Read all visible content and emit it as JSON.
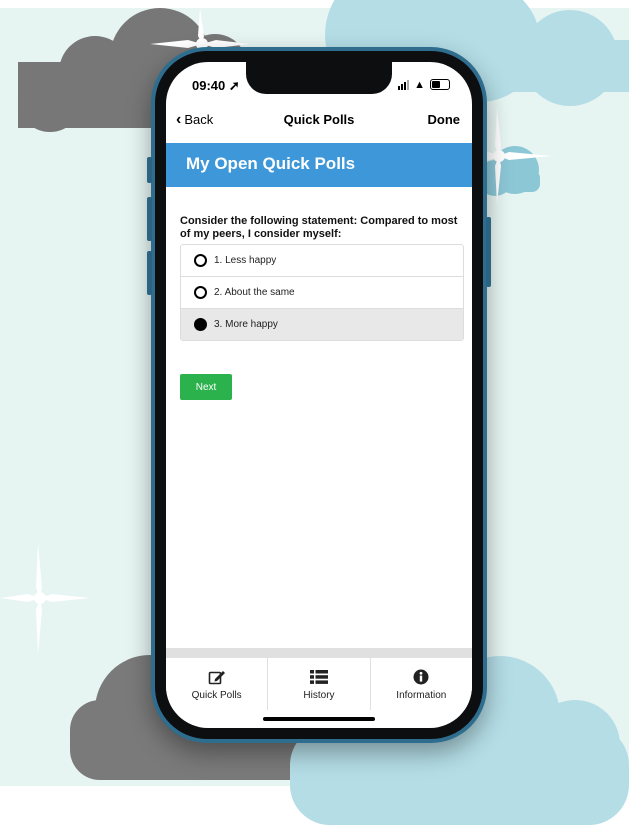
{
  "status": {
    "time": "09:40"
  },
  "nav": {
    "back_label": "Back",
    "title": "Quick Polls",
    "done_label": "Done"
  },
  "header": {
    "title": "My Open Quick Polls"
  },
  "poll": {
    "question": "Consider the following statement: Compared to most of my peers, I consider myself:",
    "options": [
      {
        "label": "1. Less happy",
        "selected": false
      },
      {
        "label": "2. About the same",
        "selected": false
      },
      {
        "label": "3. More happy",
        "selected": true
      }
    ],
    "next_label": "Next"
  },
  "tabs": [
    {
      "label": "Quick Polls",
      "icon": "edit-icon"
    },
    {
      "label": "History",
      "icon": "list-icon"
    },
    {
      "label": "Information",
      "icon": "info-icon"
    }
  ],
  "colors": {
    "header": "#3d97d8",
    "next_button": "#2bb24c",
    "background": "#e6f4f2",
    "cloud_blue": "#b4dde6",
    "cloud_gray": "#7a7a7a"
  }
}
